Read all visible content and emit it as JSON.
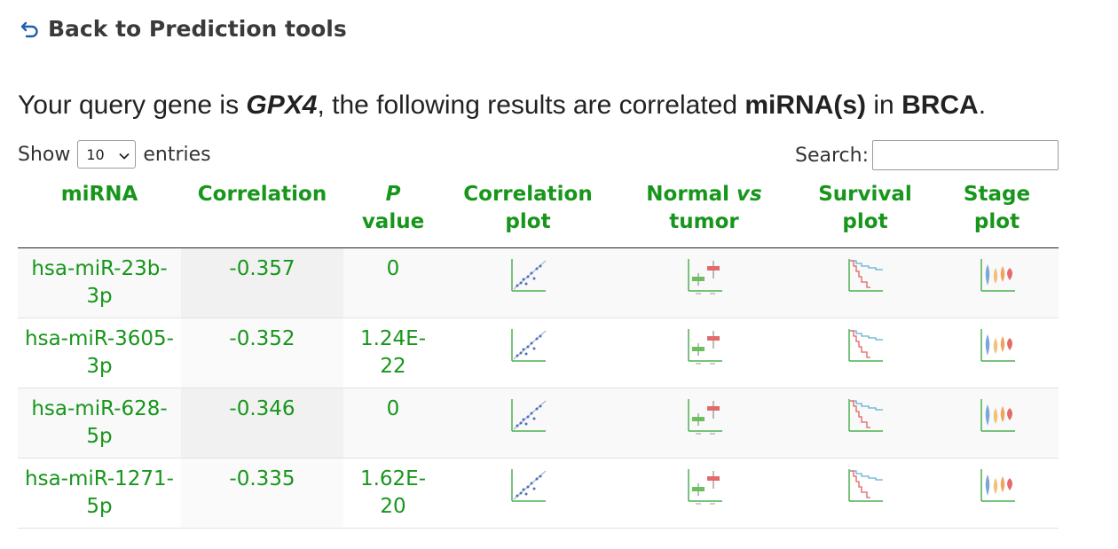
{
  "nav": {
    "back_label": "Back to Prediction tools"
  },
  "query": {
    "prefix": "Your query gene is ",
    "gene": "GPX4",
    "middle": ", the following results are correlated ",
    "entity": "miRNA(s)",
    "in_text": " in ",
    "cancer": "BRCA",
    "suffix": "."
  },
  "controls": {
    "show_label": "Show",
    "entries_value": "10",
    "entries_label": "entries",
    "search_label": "Search:",
    "search_value": ""
  },
  "table": {
    "headers": {
      "mirna": "miRNA",
      "correlation": "Correlation",
      "p_italic": "P",
      "p_rest": "value",
      "corr_plot_1": "Correlation",
      "corr_plot_2": "plot",
      "nvt_1": "Normal",
      "nvt_vs": "vs",
      "nvt_2": "tumor",
      "surv_1": "Survival",
      "surv_2": "plot",
      "stage_1": "Stage",
      "stage_2": "plot"
    },
    "rows": [
      {
        "mirna": "hsa-miR-23b-3p",
        "correlation": "-0.357",
        "p_value": "0"
      },
      {
        "mirna": "hsa-miR-3605-3p",
        "correlation": "-0.352",
        "p_value": "1.24E-22"
      },
      {
        "mirna": "hsa-miR-628-5p",
        "correlation": "-0.346",
        "p_value": "0"
      },
      {
        "mirna": "hsa-miR-1271-5p",
        "correlation": "-0.335",
        "p_value": "1.62E-20"
      }
    ]
  },
  "icons": {
    "back": "undo-arrow-icon",
    "select": "chevron-down-icon",
    "correlation_plot": "scatter-plot-thumbnail-icon",
    "normal_vs_tumor": "boxplot-thumbnail-icon",
    "survival_plot": "survival-curve-thumbnail-icon",
    "stage_plot": "violin-plot-thumbnail-icon"
  },
  "colors": {
    "accent_green": "#17961b",
    "text_dark": "#222222",
    "border": "#9a9a9a"
  }
}
